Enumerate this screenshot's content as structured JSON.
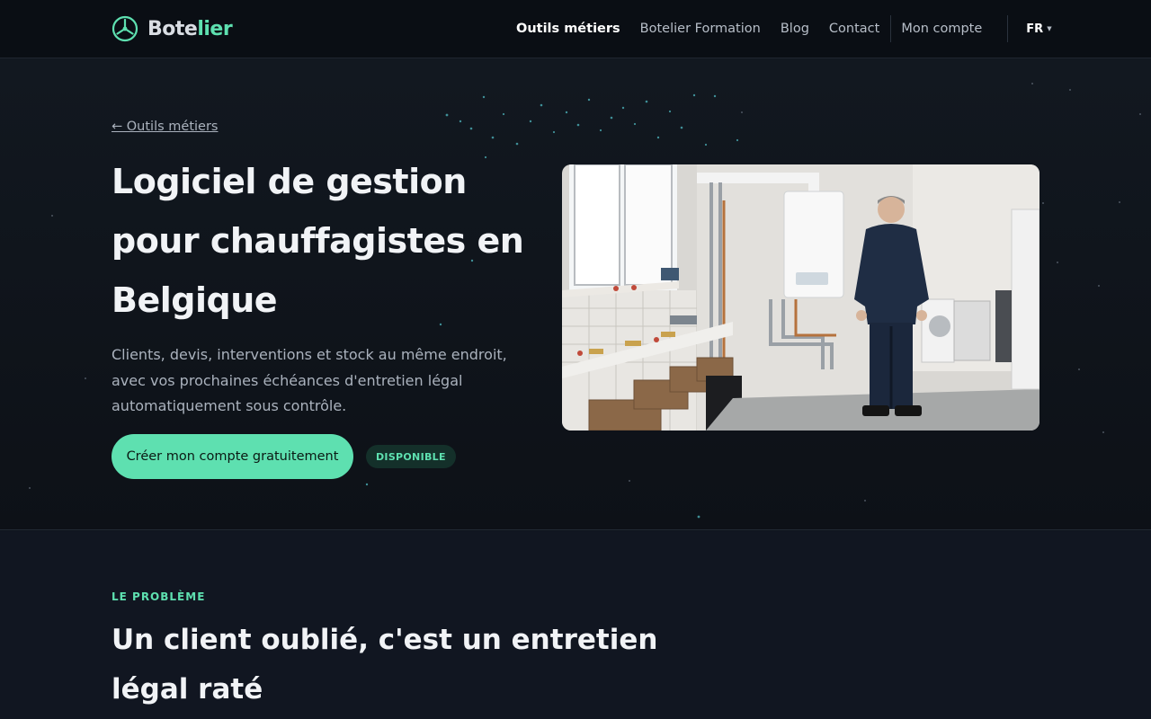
{
  "brand": {
    "name_part1": "Bote",
    "name_part2": "lier",
    "accent_color": "#5ee0b0"
  },
  "nav": {
    "items": [
      {
        "label": "Outils métiers",
        "active": true
      },
      {
        "label": "Botelier Formation",
        "active": false
      },
      {
        "label": "Blog",
        "active": false
      },
      {
        "label": "Contact",
        "active": false
      }
    ],
    "account_label": "Mon compte",
    "language": "FR",
    "language_icon": "chevron-down-icon"
  },
  "hero": {
    "back_link": "← Outils métiers",
    "title": "Logiciel de gestion pour chauffagistes en Belgique",
    "description": "Clients, devis, interventions et stock au même endroit, avec vos prochaines échéances d'entretien légal automatiquement sous contrôle.",
    "cta_label": "Créer mon compte gratuitement",
    "badge": "DISPONIBLE",
    "image_subject": "heating technician standing next to wall-mounted boiler in workshop"
  },
  "problem": {
    "eyebrow": "LE PROBLÈME",
    "title": "Un client oublié, c'est un entretien légal raté"
  }
}
